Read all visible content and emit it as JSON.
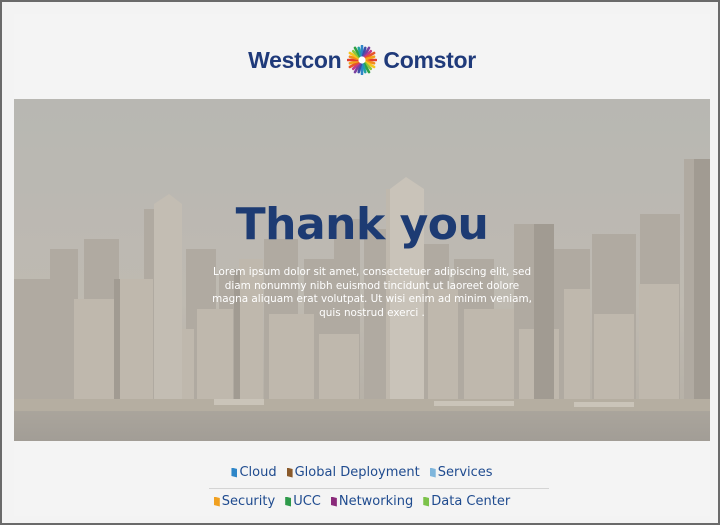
{
  "header": {
    "brand_left": "Westcon",
    "brand_right": "Comstor",
    "logo_icon": "starburst-icon"
  },
  "hero": {
    "title": "Thank you",
    "body": "Lorem ipsum dolor sit amet, consectetuer adipiscing elit, sed diam nonummy nibh euismod tincidunt ut laoreet dolore magna aliquam erat volutpat. Ut wisi enim ad minim veniam, quis nostrud exerci ."
  },
  "footer": {
    "row1": [
      {
        "label": "Cloud",
        "color": "#2e86c8"
      },
      {
        "label": "Global Deployment",
        "color": "#8a5a2b"
      },
      {
        "label": "Services",
        "color": "#7fb6dc"
      }
    ],
    "row2": [
      {
        "label": "Security",
        "color": "#f0a020"
      },
      {
        "label": "UCC",
        "color": "#2e9a4a"
      },
      {
        "label": "Networking",
        "color": "#8a2a7a"
      },
      {
        "label": "Data Center",
        "color": "#7cc24a"
      }
    ]
  },
  "colors": {
    "brand_blue": "#1f3a7a",
    "title_blue": "#1d3b73",
    "tag_text": "#1f4b8f"
  }
}
